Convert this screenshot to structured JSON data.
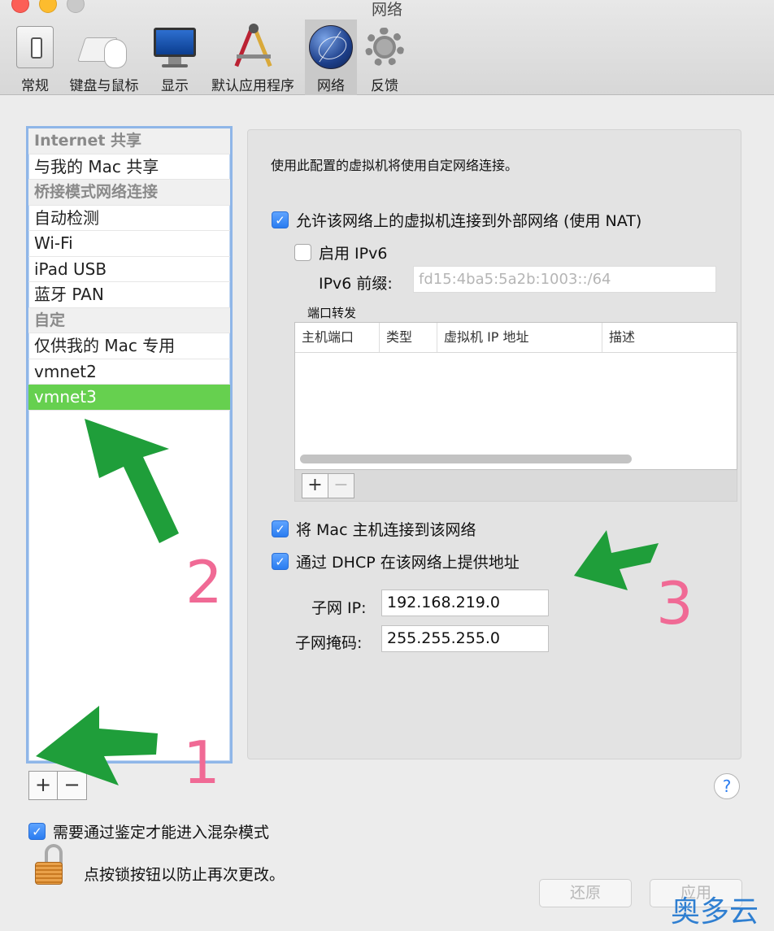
{
  "window": {
    "title": "网络"
  },
  "toolbar": {
    "items": [
      {
        "label": "常规",
        "icon": "general-switch-icon"
      },
      {
        "label": "键盘与鼠标",
        "icon": "keyboard-mouse-icon"
      },
      {
        "label": "显示",
        "icon": "display-icon"
      },
      {
        "label": "默认应用程序",
        "icon": "default-apps-icon"
      },
      {
        "label": "网络",
        "icon": "network-globe-icon",
        "active": true
      },
      {
        "label": "反馈",
        "icon": "feedback-gear-icon"
      }
    ]
  },
  "sidebar": {
    "rows": [
      {
        "label": "Internet 共享",
        "type": "header"
      },
      {
        "label": "与我的 Mac 共享",
        "type": "item"
      },
      {
        "label": "桥接模式网络连接",
        "type": "header"
      },
      {
        "label": "自动检测",
        "type": "item"
      },
      {
        "label": "Wi-Fi",
        "type": "item"
      },
      {
        "label": "iPad USB",
        "type": "item"
      },
      {
        "label": "蓝牙 PAN",
        "type": "item"
      },
      {
        "label": "自定",
        "type": "header"
      },
      {
        "label": "仅供我的 Mac 专用",
        "type": "item"
      },
      {
        "label": "vmnet2",
        "type": "item"
      },
      {
        "label": "vmnet3",
        "type": "item",
        "selected": true
      }
    ],
    "add_label": "+",
    "remove_label": "−"
  },
  "pane": {
    "description": "使用此配置的虚拟机将使用自定网络连接。",
    "nat": {
      "label": "允许该网络上的虚拟机连接到外部网络 (使用 NAT)",
      "checked": true
    },
    "ipv6": {
      "label": "启用 IPv6",
      "checked": false
    },
    "ipv6_prefix": {
      "label": "IPv6 前缀:",
      "value": "fd15:4ba5:5a2b:1003::/64"
    },
    "port_forwarding": {
      "label": "端口转发",
      "columns": [
        "主机端口",
        "类型",
        "虚拟机 IP 地址",
        "描述"
      ],
      "add_label": "+",
      "remove_label": "−"
    },
    "connect_host": {
      "label": "将 Mac 主机连接到该网络",
      "checked": true
    },
    "dhcp": {
      "label": "通过 DHCP 在该网络上提供地址",
      "checked": true
    },
    "subnet_ip": {
      "label": "子网 IP:",
      "value": "192.168.219.0"
    },
    "subnet_mask": {
      "label": "子网掩码:",
      "value": "255.255.255.0"
    }
  },
  "footer": {
    "help_label": "?",
    "promiscuous": {
      "label": "需要通过鉴定才能进入混杂模式",
      "checked": true
    },
    "lock_text": "点按锁按钮以防止再次更改。",
    "revert_label": "还原",
    "apply_label": "应用"
  },
  "annotations": {
    "numbers": [
      "1",
      "2",
      "3"
    ],
    "arrow_color": "#1f9e3a",
    "number_color": "#f06a95"
  },
  "watermark": "奥多云",
  "colors": {
    "selection": "#66d04f",
    "checkbox": "#2a7cf0",
    "sidebar_focus": "#8fb6e8"
  }
}
